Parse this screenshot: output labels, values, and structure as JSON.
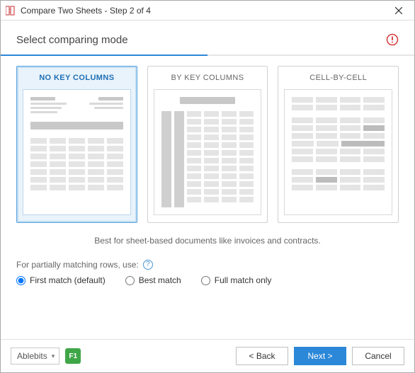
{
  "window": {
    "title": "Compare Two Sheets - Step 2 of 4"
  },
  "header": {
    "heading": "Select comparing mode"
  },
  "progress": {
    "current": 2,
    "total": 4
  },
  "modes": [
    {
      "id": "no-key",
      "label": "NO KEY COLUMNS",
      "selected": true
    },
    {
      "id": "by-key",
      "label": "BY KEY COLUMNS",
      "selected": false
    },
    {
      "id": "cell",
      "label": "CELL-BY-CELL",
      "selected": false
    }
  ],
  "description": "Best for sheet-based documents like invoices and contracts.",
  "partial": {
    "label": "For partially matching rows, use:",
    "options": [
      {
        "id": "first",
        "label": "First match (default)",
        "checked": true
      },
      {
        "id": "best",
        "label": "Best match",
        "checked": false
      },
      {
        "id": "full",
        "label": "Full match only",
        "checked": false
      }
    ]
  },
  "footer": {
    "brand": "Ablebits",
    "help_key": "F1",
    "back": "< Back",
    "next": "Next >",
    "cancel": "Cancel"
  }
}
